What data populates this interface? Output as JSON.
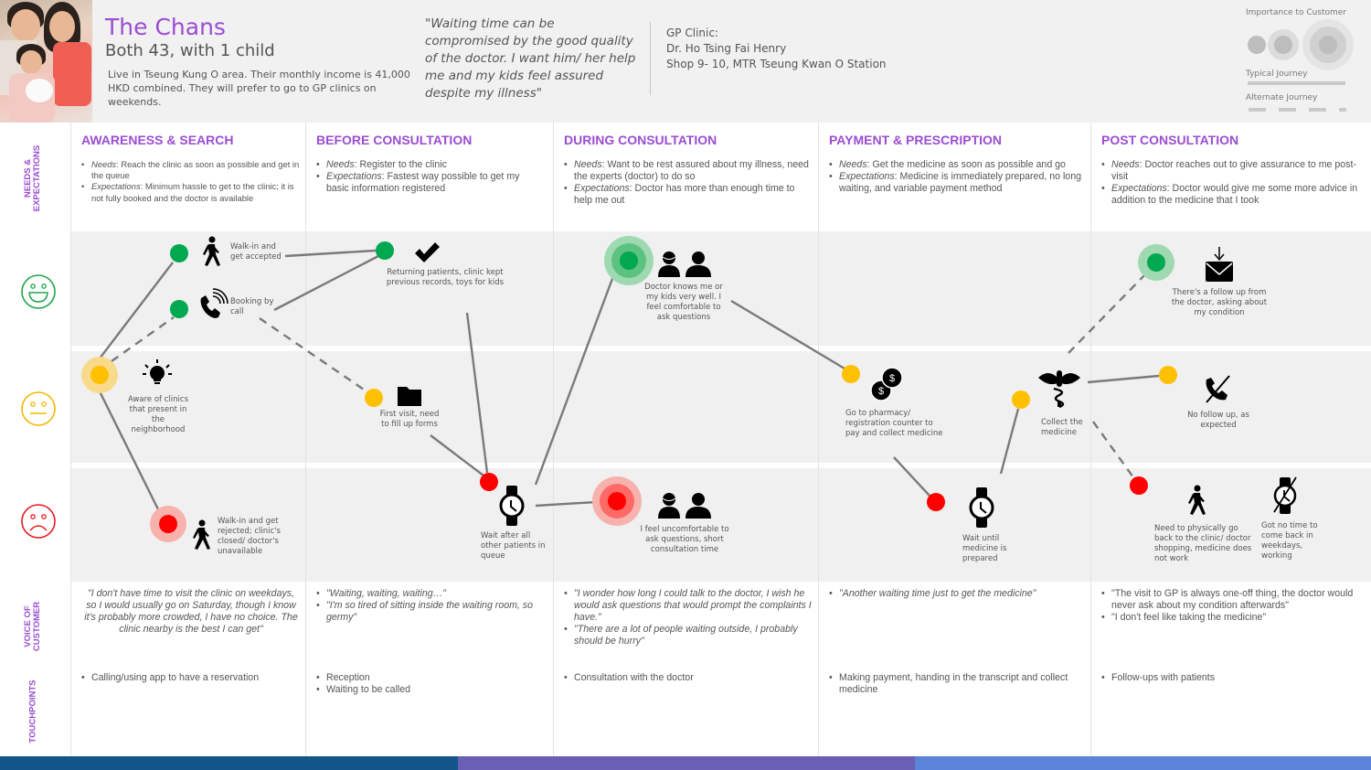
{
  "persona": {
    "name": "The Chans",
    "subtitle": "Both 43, with 1 child",
    "description": "Live in Tseung Kung O area. Their monthly income is 41,000 HKD combined. They will prefer to go to GP clinics on weekends.",
    "quote": "\"Waiting time can be compromised by the good quality of the doctor. I want him/ her help me and my kids feel assured despite my illness\""
  },
  "clinic": {
    "line1": "GP Clinic:",
    "line2": "Dr. Ho Tsing Fai Henry",
    "line3": "Shop 9- 10, MTR Tseung Kwan O Station"
  },
  "legend": {
    "importance": "Importance to Customer",
    "typical": "Typical Journey",
    "alternate": "Alternate Journey"
  },
  "row_labels": {
    "needs": "NEEDS & EXPECTATIONS",
    "voice": "VOICE OF CUSTOMER",
    "touchpoints": "TOUCHPOINTS"
  },
  "emotions": {
    "happy": {
      "icon": "happy-face-icon",
      "color": "#1fa64a"
    },
    "neutral": {
      "icon": "neutral-face-icon",
      "color": "#f5b800"
    },
    "sad": {
      "icon": "sad-face-icon",
      "color": "#e81c1c"
    }
  },
  "colors": {
    "accent": "#9b4dd1",
    "positive": "#00a84f",
    "neutral": "#ffc000",
    "negative": "#ff0000",
    "footer": [
      "#125689",
      "#6a5eb5",
      "#5b84d9"
    ]
  },
  "phases": [
    {
      "title": "AWARENESS & SEARCH",
      "needs_label": "Needs",
      "needs": ": Reach the clinic as soon as possible and get in the queue",
      "expectations_label": "Expectations",
      "expectations": ": Minimum hassle to get to the clinic; it is not fully booked and the doctor is available",
      "voice": [
        "\"I don't have time to visit the clinic on weekdays, so I would usually go on Saturday, though I know it's probably more crowded, I have no choice. The clinic nearby is the best I can get\""
      ],
      "touchpoints": [
        "Calling/using app to have a reservation"
      ]
    },
    {
      "title": "BEFORE CONSULTATION",
      "needs_label": "Needs",
      "needs": ": Register to the clinic",
      "expectations_label": "Expectations",
      "expectations": ": Fastest way possible to get my basic information registered",
      "voice": [
        "\"Waiting, waiting, waiting…\"",
        "\"I'm so tired of sitting inside the waiting room, so germy\""
      ],
      "touchpoints": [
        "Reception",
        "Waiting to be called"
      ]
    },
    {
      "title": "DURING CONSULTATION",
      "needs_label": "Needs",
      "needs": ": Want to be rest assured about my illness, need the experts (doctor) to do so",
      "expectations_label": "Expectations",
      "expectations": ": Doctor has more than enough time to help me out",
      "voice": [
        "\"I wonder how long I could talk to the doctor, I wish he would ask questions that would prompt the complaints I have.\"",
        "\"There are a lot of people waiting outside, I probably should be hurry\""
      ],
      "touchpoints": [
        "Consultation with the doctor"
      ]
    },
    {
      "title": "PAYMENT & PRESCRIPTION",
      "needs_label": "Needs",
      "needs": ": Get the medicine as soon as possible and go",
      "expectations_label": "Expectations",
      "expectations": ": Medicine is immediately prepared, no long waiting, and variable payment method",
      "voice": [
        "\"Another waiting time just to get the medicine\""
      ],
      "touchpoints": [
        "Making payment, handing in the transcript and collect medicine"
      ]
    },
    {
      "title": "POST CONSULTATION",
      "needs_label": "Needs",
      "needs": ": Doctor reaches out to give assurance to me post-visit",
      "expectations_label": "Expectations",
      "expectations": ": Doctor would give me some more advice in addition to the medicine that I took",
      "voice": [
        "\"The visit to GP is always one-off thing, the doctor would never ask about my condition afterwards\"",
        "\"I don't feel like taking the medicine\""
      ],
      "touchpoints": [
        "Follow-ups with patients"
      ]
    }
  ],
  "journey_points": [
    {
      "id": "aware",
      "emotion": "neutral",
      "importance": 2,
      "icon": "lightbulb-icon",
      "label": "Aware of clinics that present in the neighborhood"
    },
    {
      "id": "walkin-ok",
      "emotion": "happy",
      "importance": 1,
      "icon": "walking-person-icon",
      "label": "Walk-in and get accepted"
    },
    {
      "id": "booking",
      "emotion": "happy",
      "importance": 1,
      "icon": "phone-call-icon",
      "label": "Booking by call"
    },
    {
      "id": "walkin-rejected",
      "emotion": "sad",
      "importance": 2,
      "icon": "walking-person-icon",
      "label": "Walk-in and get rejected; clinic's closed/ doctor's unavailable"
    },
    {
      "id": "returning",
      "emotion": "happy",
      "importance": 1,
      "icon": "checkmark-icon",
      "label": "Returning patients, clinic kept previous records, toys for kids"
    },
    {
      "id": "first-visit",
      "emotion": "neutral",
      "importance": 1,
      "icon": "folder-icon",
      "label": "First visit, need to fill up forms"
    },
    {
      "id": "wait-queue",
      "emotion": "sad",
      "importance": 1,
      "icon": "watch-icon",
      "label": "Wait after all other patients in queue"
    },
    {
      "id": "doctor-knows",
      "emotion": "happy",
      "importance": 3,
      "icon": "doctor-patient-icon",
      "label": "Doctor knows me or my kids very well. I feel comfortable to ask questions"
    },
    {
      "id": "uncomfortable",
      "emotion": "sad",
      "importance": 3,
      "icon": "doctor-patient-icon",
      "label": "I feel uncomfortable to ask questions, short consultation time"
    },
    {
      "id": "pharmacy",
      "emotion": "neutral",
      "importance": 1,
      "icon": "coins-icon",
      "label": "Go to pharmacy/ registration counter to pay and collect medicine"
    },
    {
      "id": "wait-medicine",
      "emotion": "sad",
      "importance": 1,
      "icon": "watch-icon",
      "label": "Wait until medicine is prepared"
    },
    {
      "id": "collect",
      "emotion": "neutral",
      "importance": 1,
      "icon": "caduceus-icon",
      "label": "Collect the medicine"
    },
    {
      "id": "followup",
      "emotion": "happy",
      "importance": 2,
      "icon": "mail-icon",
      "label": "There's a follow up from the doctor, asking about my condition"
    },
    {
      "id": "no-followup",
      "emotion": "neutral",
      "importance": 1,
      "icon": "no-phone-icon",
      "label": "No follow up, as expected"
    },
    {
      "id": "go-back",
      "emotion": "sad",
      "importance": 1,
      "icon": "walking-person-icon",
      "label": "Need to physically go back to the clinic/ doctor shopping, medicine does not work"
    },
    {
      "id": "no-time",
      "emotion": "sad",
      "importance": 1,
      "icon": "no-watch-icon",
      "label": "Got no time to come back in weekdays, working"
    }
  ],
  "journey_links": [
    {
      "from": "aware",
      "to": "walkin-ok",
      "type": "typical"
    },
    {
      "from": "aware",
      "to": "booking",
      "type": "alternate"
    },
    {
      "from": "aware",
      "to": "walkin-rejected",
      "type": "typical"
    },
    {
      "from": "walkin-ok",
      "to": "returning",
      "type": "typical"
    },
    {
      "from": "booking",
      "to": "returning",
      "type": "typical"
    },
    {
      "from": "booking",
      "to": "first-visit",
      "type": "alternate"
    },
    {
      "from": "returning",
      "to": "wait-queue",
      "type": "typical"
    },
    {
      "from": "first-visit",
      "to": "wait-queue",
      "type": "typical"
    },
    {
      "from": "wait-queue",
      "to": "doctor-knows",
      "type": "typical"
    },
    {
      "from": "wait-queue",
      "to": "uncomfortable",
      "type": "typical"
    },
    {
      "from": "doctor-knows",
      "to": "pharmacy",
      "type": "typical"
    },
    {
      "from": "pharmacy",
      "to": "wait-medicine",
      "type": "typical"
    },
    {
      "from": "wait-medicine",
      "to": "collect",
      "type": "typical"
    },
    {
      "from": "collect",
      "to": "followup",
      "type": "alternate"
    },
    {
      "from": "collect",
      "to": "no-followup",
      "type": "typical"
    },
    {
      "from": "collect",
      "to": "go-back",
      "type": "alternate"
    }
  ]
}
